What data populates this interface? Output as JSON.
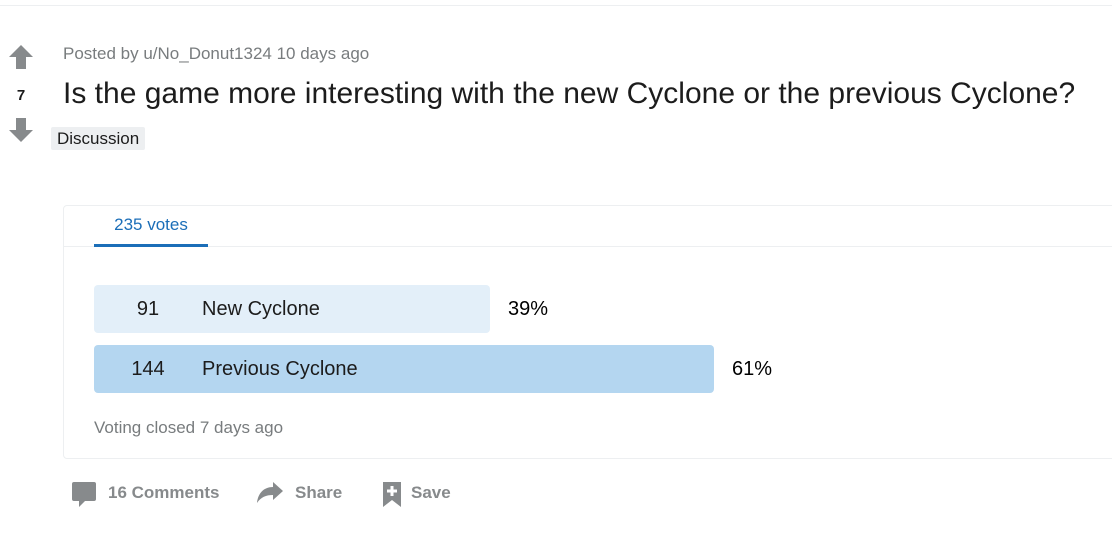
{
  "post": {
    "score": "7",
    "posted_by": "Posted by u/No_Donut1324 10 days ago",
    "title": "Is the game more interesting with the new Cyclone or the previous Cyclone?",
    "flair": "Discussion"
  },
  "poll": {
    "tab_label": "235 votes",
    "options": [
      {
        "count": "91",
        "label": "New Cyclone",
        "percent": "39%",
        "share": 0.39,
        "color": "#e3eff9"
      },
      {
        "count": "144",
        "label": "Previous Cyclone",
        "percent": "61%",
        "share": 0.61,
        "color": "#b4d6f0"
      }
    ],
    "status": "Voting closed 7 days ago"
  },
  "actions": {
    "comments": "16 Comments",
    "share": "Share",
    "save": "Save"
  },
  "icons": {
    "upvote": "upvote-arrow-icon",
    "downvote": "downvote-arrow-icon",
    "comments": "comment-bubble-icon",
    "share": "share-arrow-icon",
    "save": "bookmark-plus-icon"
  },
  "colors": {
    "accent": "#1b6eb8",
    "muted_text": "#787c7e",
    "action_text": "#878a8c"
  }
}
